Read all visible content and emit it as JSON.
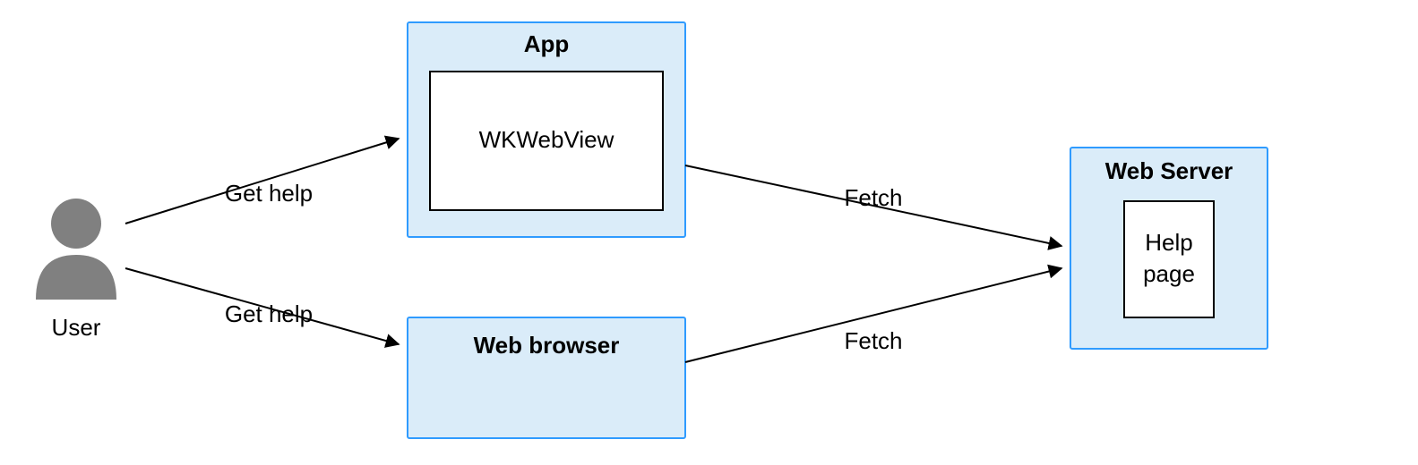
{
  "nodes": {
    "user": {
      "label": "User"
    },
    "app": {
      "title": "App",
      "inner": "WKWebView"
    },
    "browser": {
      "title": "Web browser"
    },
    "server": {
      "title": "Web Server",
      "inner": "Help\npage"
    }
  },
  "edges": {
    "user_to_app": {
      "label": "Get help"
    },
    "user_to_browser": {
      "label": "Get help"
    },
    "app_to_server": {
      "label": "Fetch"
    },
    "browser_to_server": {
      "label": "Fetch"
    }
  },
  "colors": {
    "box_fill": "#daecf9",
    "box_stroke": "#2f9bff",
    "user_fill": "#808080"
  }
}
